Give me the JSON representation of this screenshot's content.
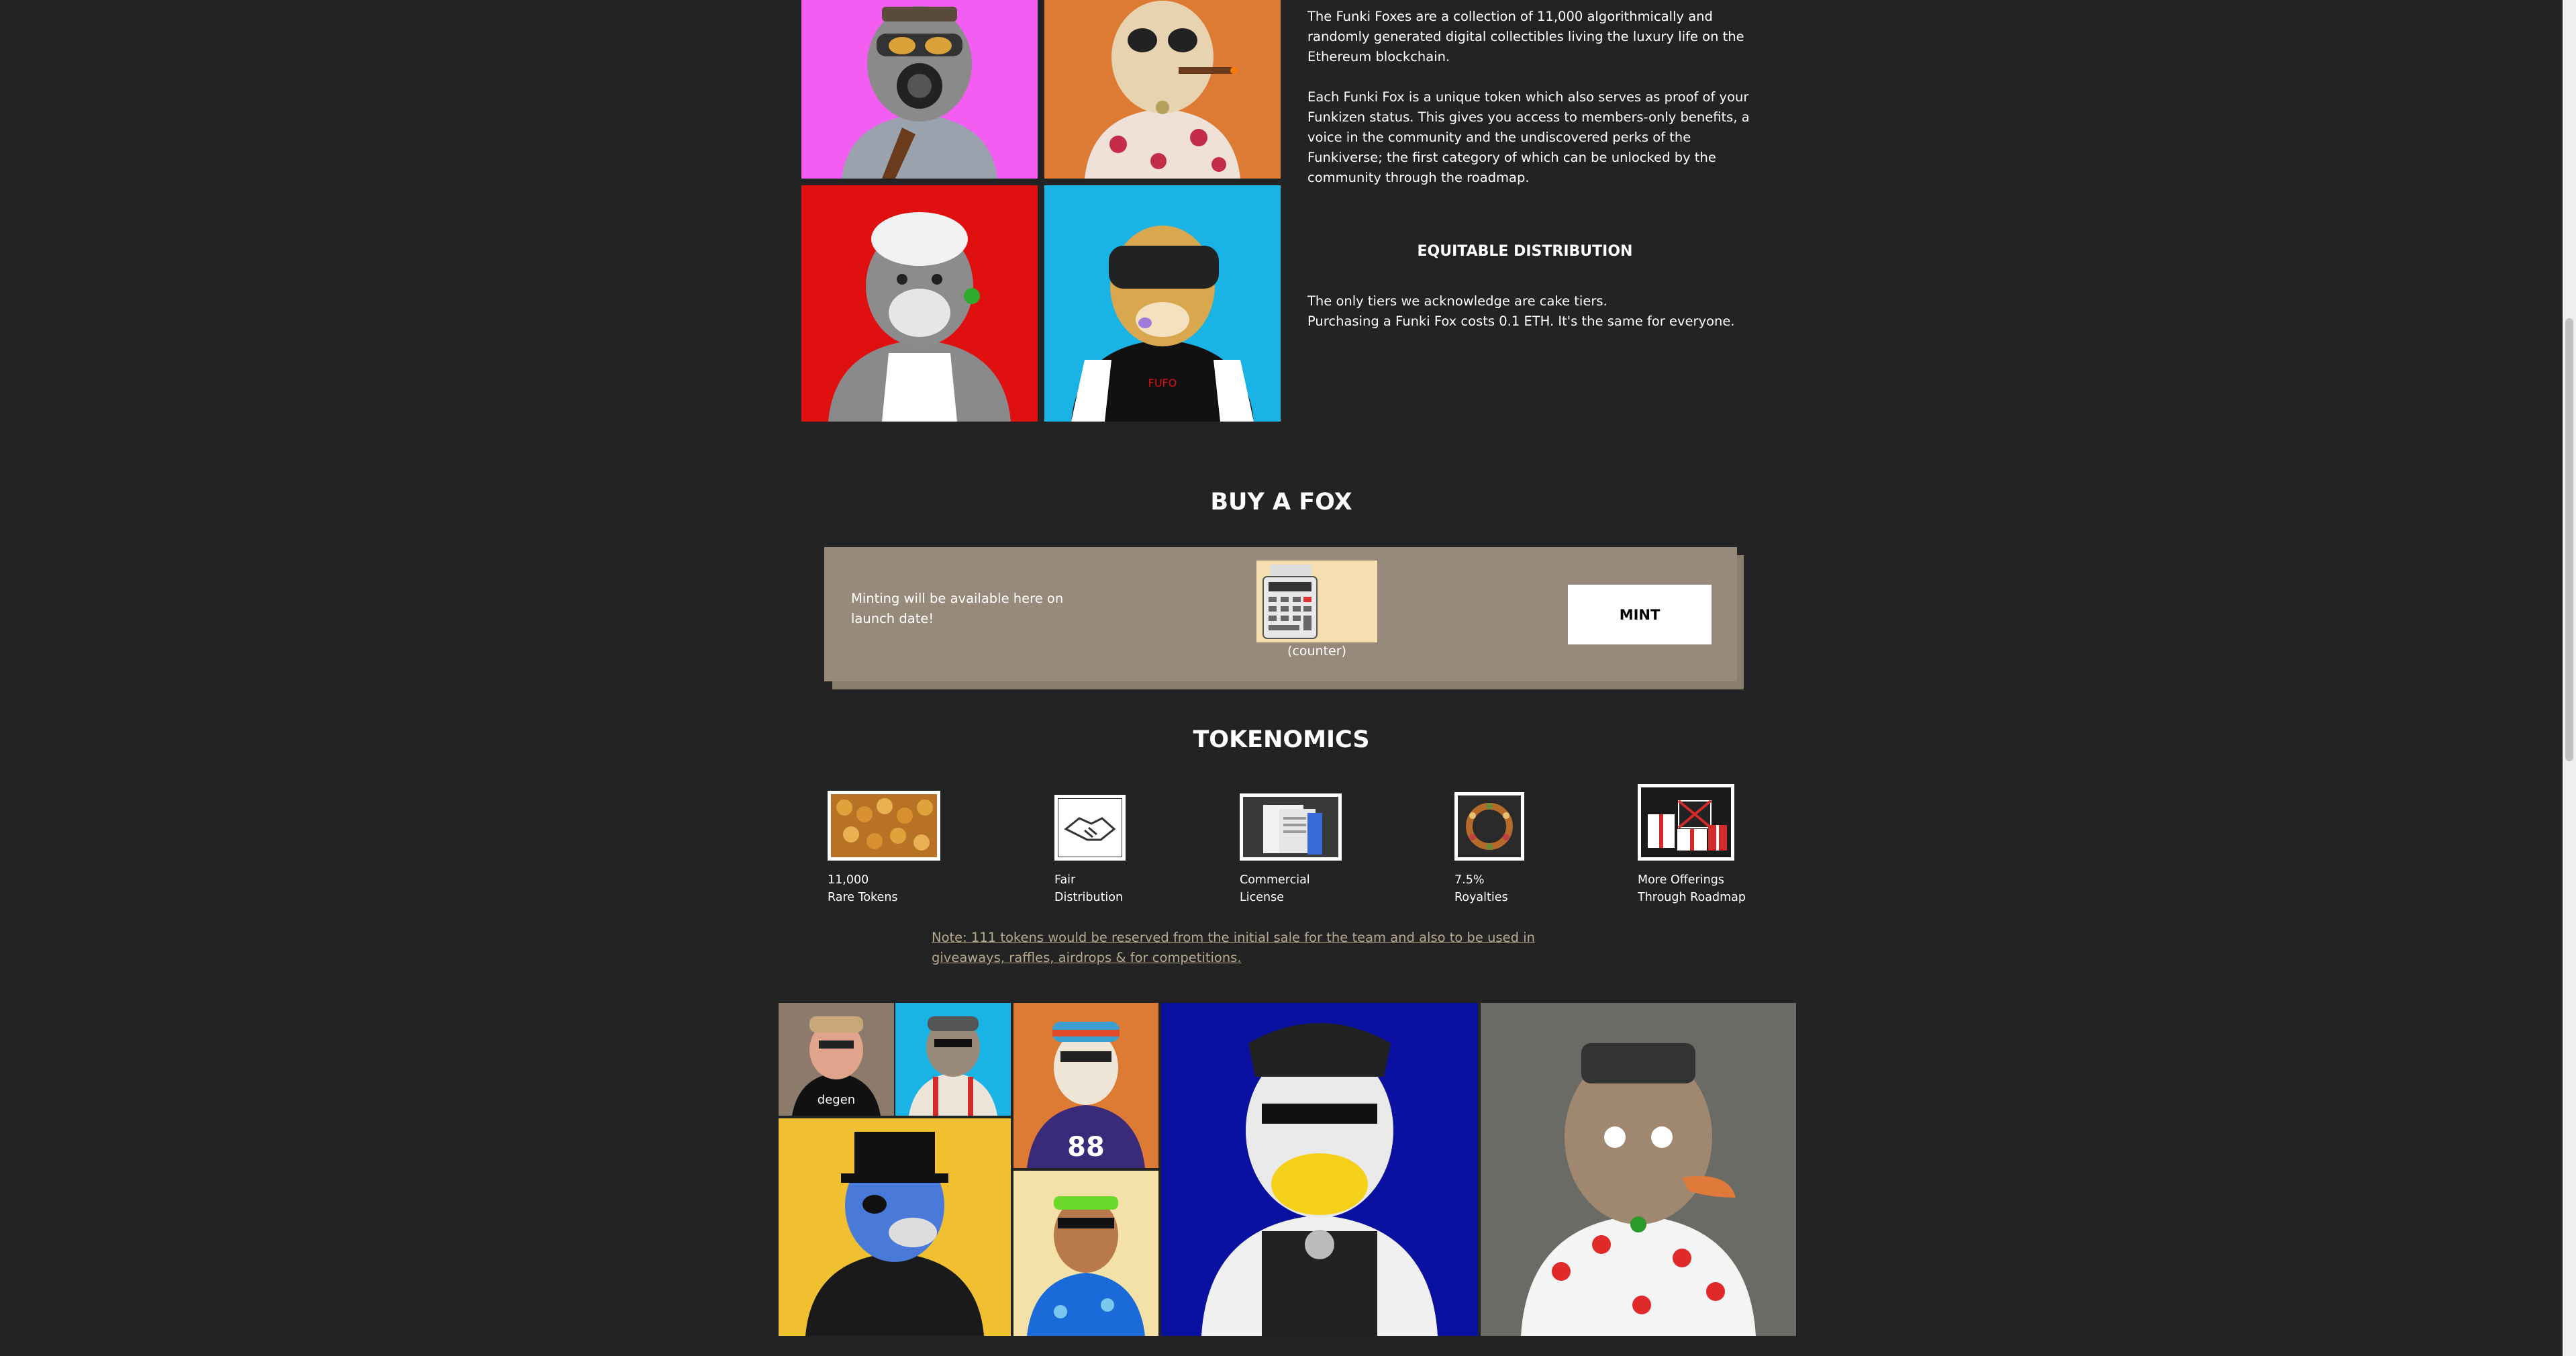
{
  "about": {
    "paragraph_1": "The Funki Foxes are a collection of 11,000 algorithmically and randomly generated digital collectibles living the luxury life on the Ethereum blockchain.",
    "paragraph_2": "Each Funki Fox is a unique token which also serves as proof of your Funkizen status. This gives you access to members-only benefits, a voice in the community and the undiscovered perks of the Funkiverse; the first category of which can be unlocked by the community through the roadmap.",
    "distribution_heading": "EQUITABLE DISTRIBUTION",
    "distribution_line_1": "The only tiers we acknowledge are cake tiers.",
    "distribution_line_2": "Purchasing a Funki Fox costs 0.1 ETH. It's the same for everyone."
  },
  "fox_tiles_top": [
    {
      "name": "fox-robot-gas-mask",
      "bg": "#f45df2"
    },
    {
      "name": "fox-cigar-floral",
      "bg": "#dd7a33"
    },
    {
      "name": "fox-white-hat-clover",
      "bg": "#e01010"
    },
    {
      "name": "fox-vr-headset",
      "bg": "#1ab3e6"
    }
  ],
  "buy": {
    "title": "BUY A FOX",
    "note": "Minting will be available here on launch date!",
    "counter_label": "(counter)",
    "mint_label": "MINT"
  },
  "tokenomics": {
    "title": "TOKENOMICS",
    "items": [
      {
        "icon": "gold-coins-icon",
        "line1": "11,000",
        "line2": "Rare Tokens"
      },
      {
        "icon": "handshake-icon",
        "line1": "Fair",
        "line2": "Distribution"
      },
      {
        "icon": "documents-icon",
        "line1": "Commercial",
        "line2": "License"
      },
      {
        "icon": "wreath-icon",
        "line1": "7.5%",
        "line2": "Royalties"
      },
      {
        "icon": "gift-boxes-icon",
        "line1": "More Offerings",
        "line2": "Through Roadmap"
      }
    ],
    "note": "Note: 111 tokens would be reserved from the initial sale for the team and also to be used in giveaways, raffles, airdrops & for competitions."
  },
  "gallery": {
    "shirt_text_degen": "degen",
    "jersey_number": "88",
    "shirt_text_fufo": "FUFO"
  }
}
